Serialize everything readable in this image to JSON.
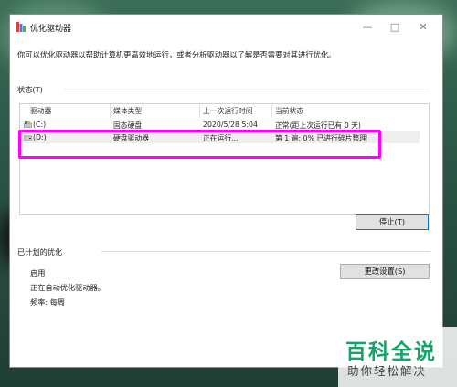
{
  "window": {
    "title": "优化驱动器",
    "min": "—",
    "max": "□",
    "close": "✕"
  },
  "description": "你可以优化驱动器以帮助计算机更高效地运行，或者分析驱动器以了解是否需要对其进行优化。",
  "status_label": "状态(T)",
  "table": {
    "columns": [
      "驱动器",
      "媒体类型",
      "上一次运行时间",
      "当前状态"
    ],
    "rows": [
      {
        "drive": "(C:)",
        "media": "固态硬盘",
        "last_run": "2020/5/28 5:04",
        "status": "正常(距上次运行已有 0 天)",
        "icon": "ssd-drive-icon"
      },
      {
        "drive": "(D:)",
        "media": "硬盘驱动器",
        "last_run": "正在运行...",
        "status": "第 1 遍: 0% 已进行碎片整理",
        "icon": "hdd-drive-icon"
      }
    ]
  },
  "stop_button": "停止(T)",
  "scheduled": {
    "label": "已计划的优化",
    "state": "启用",
    "detail": "正在自动优化驱动器。",
    "frequency": "频率: 每周",
    "change_button": "更改设置(S)"
  },
  "watermark": {
    "big": "百科全说",
    "small": "助你轻松解决"
  },
  "colors": {
    "highlight": "#ff00ff",
    "watermark_green": "#16a36a"
  }
}
